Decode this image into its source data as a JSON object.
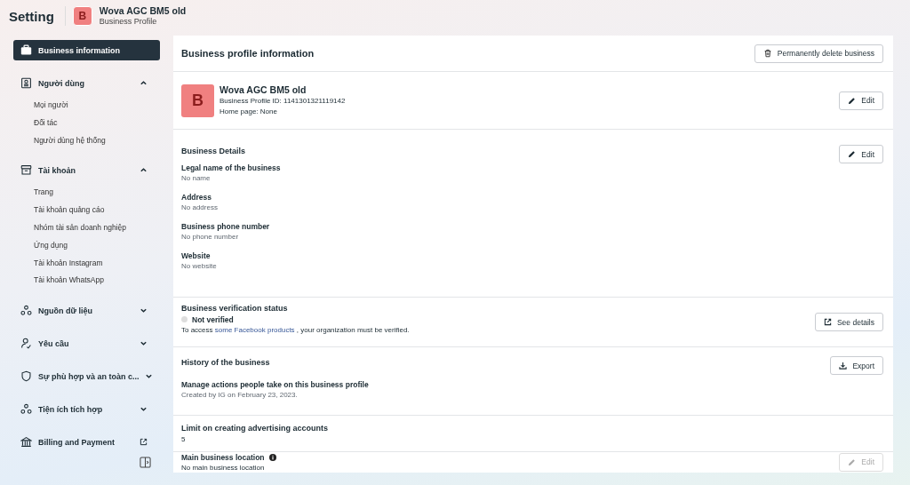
{
  "header": {
    "title": "Setting",
    "avatar_letter": "B",
    "business_name": "Wova AGC BM5 old",
    "subtitle": "Business Profile"
  },
  "sidebar": {
    "items": [
      {
        "kind": "link",
        "label": "Business information",
        "selected": true
      },
      {
        "kind": "group",
        "label": "Người dùng",
        "expanded": true,
        "selected": false,
        "children": [
          {
            "label": "Mọi người",
            "selected": false
          },
          {
            "label": "Đối tác",
            "selected": false
          },
          {
            "label": "Người dùng hệ thống",
            "selected": false
          }
        ]
      },
      {
        "kind": "group",
        "label": "Tài khoản",
        "expanded": true,
        "selected": false,
        "children": [
          {
            "label": "Trang",
            "selected": false
          },
          {
            "label": "Tài khoản quảng cáo",
            "selected": false
          },
          {
            "label": "Nhóm tài sản doanh nghiệp",
            "selected": false
          },
          {
            "label": "Ứng dụng",
            "selected": false
          },
          {
            "label": "Tài khoản Instagram",
            "selected": false
          },
          {
            "label": "Tài khoản WhatsApp",
            "selected": false
          }
        ]
      },
      {
        "kind": "group",
        "label": "Nguồn dữ liệu",
        "expanded": false,
        "selected": false
      },
      {
        "kind": "group",
        "label": "Yêu cầu",
        "expanded": false,
        "selected": false
      },
      {
        "kind": "group",
        "label": "Sự phù hợp và an toàn c...",
        "expanded": false,
        "selected": false
      },
      {
        "kind": "group",
        "label": "Tiện ích tích hợp",
        "expanded": false,
        "selected": false
      },
      {
        "kind": "external",
        "label": "Billing and Payment",
        "selected": false
      }
    ]
  },
  "main": {
    "title": "Business profile information",
    "delete_button": "Permanently delete business",
    "sections": [
      {
        "kind": "profile",
        "avatar_letter": "B",
        "name": "Wova AGC BM5 old",
        "lines": [
          "Business Profile ID: 1141301321119142",
          "Home page: None"
        ],
        "button": {
          "label": "Edit",
          "disabled": false
        }
      },
      {
        "kind": "details",
        "title": "Business Details",
        "fields": [
          {
            "label": "Legal name of the business",
            "value": "No name"
          },
          {
            "label": "Address",
            "value": "No address"
          },
          {
            "label": "Business phone number",
            "value": "No phone number"
          },
          {
            "label": "Website",
            "value": "No website"
          }
        ],
        "button": {
          "label": "Edit",
          "disabled": false
        }
      },
      {
        "kind": "verification",
        "title": "Business verification status",
        "status": "Not verified",
        "verified": false,
        "note": "To access ",
        "link": "some Facebook products",
        "note_end": " , your organization must be verified.",
        "button": {
          "label": "See details",
          "disabled": false
        }
      },
      {
        "kind": "history",
        "title": "History of the business",
        "subtitle": "Manage actions people take on this business profile",
        "note": "Created by IG on February 23, 2023.",
        "button": {
          "label": "Export",
          "disabled": false
        }
      },
      {
        "kind": "limit",
        "title": "Limit on creating advertising accounts",
        "value": "5"
      },
      {
        "kind": "location",
        "title": "Main business location",
        "value": "No main business location",
        "button": {
          "label": "Edit",
          "disabled": true
        }
      }
    ]
  }
}
